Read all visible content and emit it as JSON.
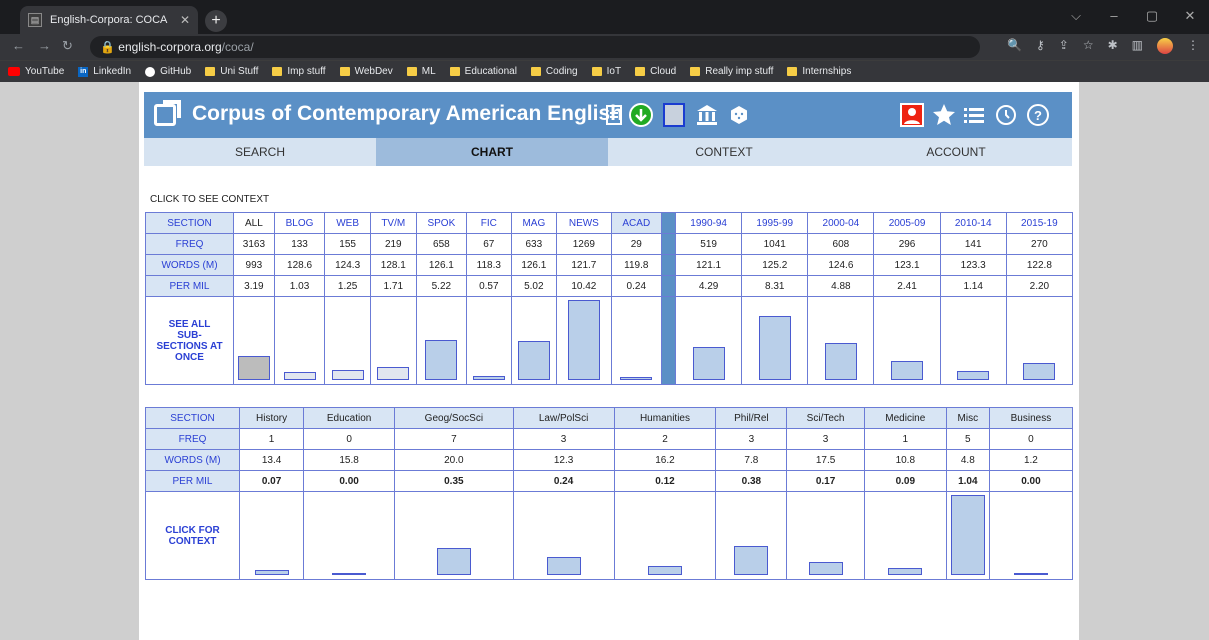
{
  "browser": {
    "tab_title": "English-Corpora: COCA",
    "url_host": "english-corpora.org",
    "url_path": "/coca/",
    "bookmarks": [
      "YouTube",
      "LinkedIn",
      "GitHub",
      "Uni Stuff",
      "Imp stuff",
      "WebDev",
      "ML",
      "Educational",
      "Coding",
      "IoT",
      "Cloud",
      "Really imp stuff",
      "Internships"
    ]
  },
  "site": {
    "title": "Corpus of Contemporary American English",
    "tabs": [
      "SEARCH",
      "CHART",
      "CONTEXT",
      "ACCOUNT"
    ],
    "active_tab": "CHART"
  },
  "hint": "CLICK TO SEE CONTEXT",
  "table1": {
    "row_labels": [
      "SECTION",
      "FREQ",
      "WORDS (M)",
      "PER MIL"
    ],
    "see_all": "SEE ALL SUB-SECTIONS AT ONCE",
    "columns": [
      {
        "section": "ALL",
        "freq": "3163",
        "words": "993",
        "permil": "3.19"
      },
      {
        "section": "BLOG",
        "freq": "133",
        "words": "128.6",
        "permil": "1.03"
      },
      {
        "section": "WEB",
        "freq": "155",
        "words": "124.3",
        "permil": "1.25"
      },
      {
        "section": "TV/M",
        "freq": "219",
        "words": "128.1",
        "permil": "1.71"
      },
      {
        "section": "SPOK",
        "freq": "658",
        "words": "126.1",
        "permil": "5.22"
      },
      {
        "section": "FIC",
        "freq": "67",
        "words": "118.3",
        "permil": "0.57"
      },
      {
        "section": "MAG",
        "freq": "633",
        "words": "126.1",
        "permil": "5.02"
      },
      {
        "section": "NEWS",
        "freq": "1269",
        "words": "121.7",
        "permil": "10.42"
      },
      {
        "section": "ACAD",
        "freq": "29",
        "words": "119.8",
        "permil": "0.24"
      },
      {
        "section": "1990-94",
        "freq": "519",
        "words": "121.1",
        "permil": "4.29"
      },
      {
        "section": "1995-99",
        "freq": "1041",
        "words": "125.2",
        "permil": "8.31"
      },
      {
        "section": "2000-04",
        "freq": "608",
        "words": "124.6",
        "permil": "4.88"
      },
      {
        "section": "2005-09",
        "freq": "296",
        "words": "123.1",
        "permil": "2.41"
      },
      {
        "section": "2010-14",
        "freq": "141",
        "words": "123.3",
        "permil": "1.14"
      },
      {
        "section": "2015-19",
        "freq": "270",
        "words": "122.8",
        "permil": "2.20"
      }
    ]
  },
  "table2": {
    "row_labels": [
      "SECTION",
      "FREQ",
      "WORDS (M)",
      "PER MIL"
    ],
    "click": "CLICK FOR CONTEXT",
    "columns": [
      {
        "section": "History",
        "freq": "1",
        "words": "13.4",
        "permil": "0.07"
      },
      {
        "section": "Education",
        "freq": "0",
        "words": "15.8",
        "permil": "0.00"
      },
      {
        "section": "Geog/SocSci",
        "freq": "7",
        "words": "20.0",
        "permil": "0.35"
      },
      {
        "section": "Law/PolSci",
        "freq": "3",
        "words": "12.3",
        "permil": "0.24"
      },
      {
        "section": "Humanities",
        "freq": "2",
        "words": "16.2",
        "permil": "0.12"
      },
      {
        "section": "Phil/Rel",
        "freq": "3",
        "words": "7.8",
        "permil": "0.38"
      },
      {
        "section": "Sci/Tech",
        "freq": "3",
        "words": "17.5",
        "permil": "0.17"
      },
      {
        "section": "Medicine",
        "freq": "1",
        "words": "10.8",
        "permil": "0.09"
      },
      {
        "section": "Misc",
        "freq": "5",
        "words": "4.8",
        "permil": "1.04"
      },
      {
        "section": "Business",
        "freq": "0",
        "words": "1.2",
        "permil": "0.00"
      }
    ]
  }
}
